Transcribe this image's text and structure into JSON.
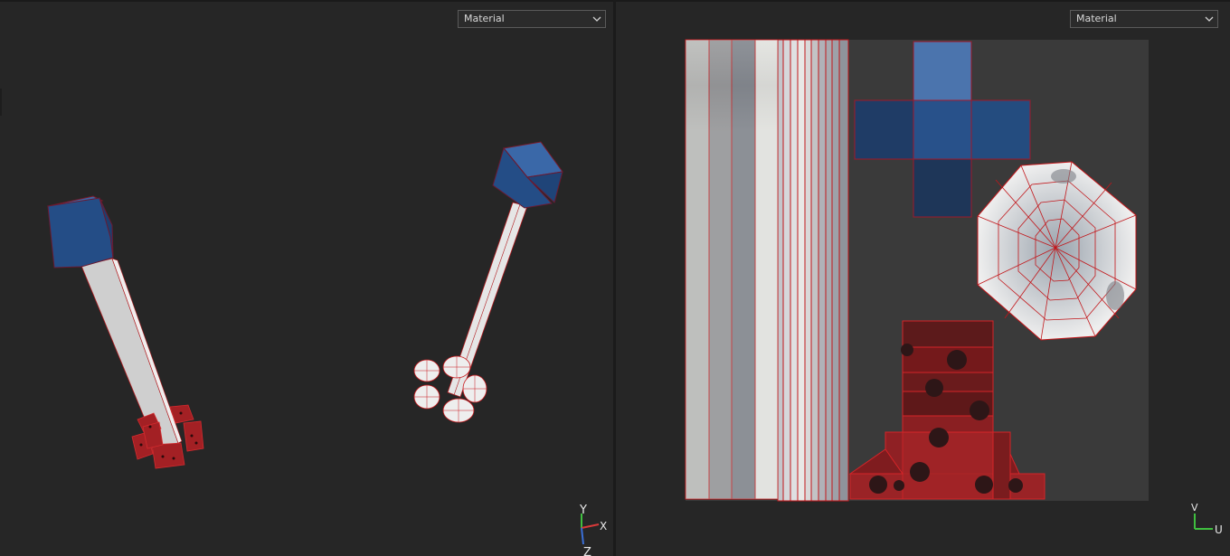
{
  "left_viewport": {
    "shading_mode": "Material",
    "axis": {
      "y": "Y",
      "x": "X",
      "z": "Z"
    }
  },
  "right_viewport": {
    "shading_mode": "Material",
    "axis": {
      "v": "V",
      "u": "U"
    }
  },
  "colors": {
    "background": "#262626",
    "mesh_blue": "#2a4f82",
    "mesh_handle": "#c9c9c9",
    "wire_red": "#c0181c",
    "selection_red": "#8e1a1c"
  },
  "icons": [
    "chevron-down-icon",
    "axis-gizmo-icon",
    "uv-axis-icon"
  ]
}
